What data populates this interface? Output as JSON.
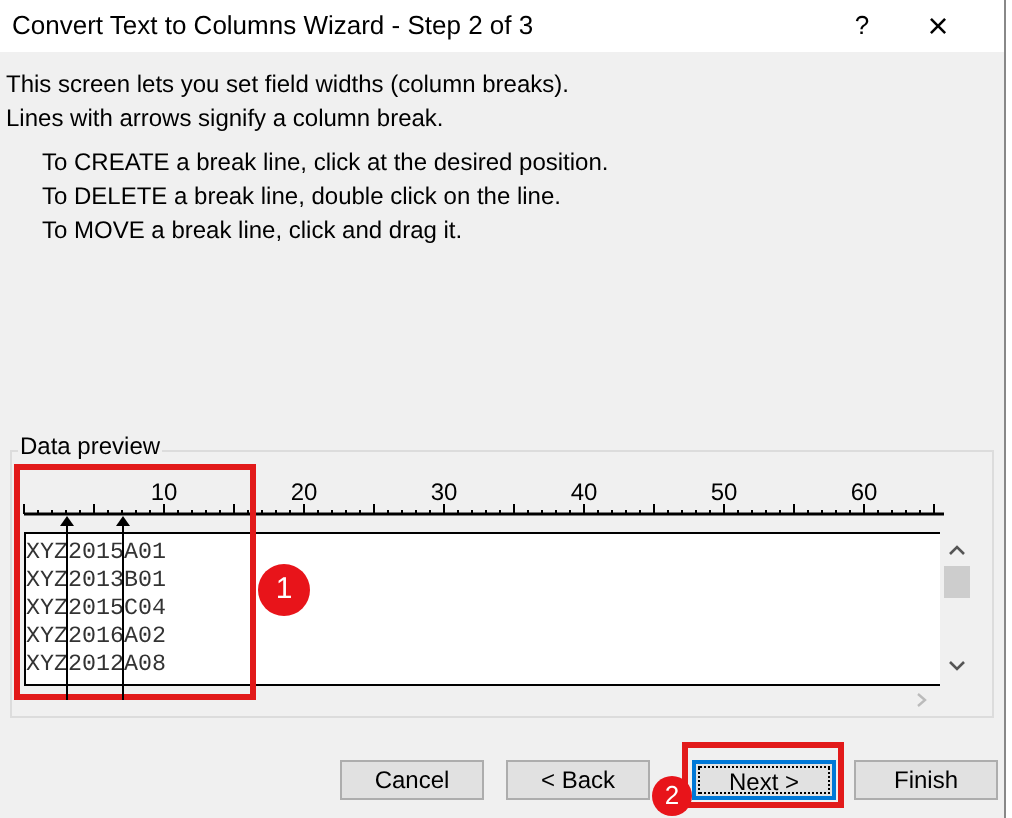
{
  "window": {
    "title": "Convert Text to Columns Wizard - Step 2 of 3",
    "help": "?",
    "close": "×"
  },
  "intro": [
    "This screen lets you set field widths (column breaks).",
    "Lines with arrows signify a column break."
  ],
  "instructions": [
    "To CREATE a break line, click at the desired position.",
    "To DELETE a break line, double click on the line.",
    "To MOVE a break line, click and drag it."
  ],
  "data_preview": {
    "label": "Data preview",
    "ruler": [
      "10",
      "20",
      "30",
      "40",
      "50",
      "60"
    ],
    "rows": [
      "XYZ2015A01",
      "XYZ2013B01",
      "XYZ2015C04",
      "XYZ2016A02",
      "XYZ2012A08"
    ]
  },
  "buttons": [
    {
      "label": "Cancel",
      "default": false
    },
    {
      "label": "< Back",
      "default": false
    },
    {
      "label": "Next >",
      "default": true
    },
    {
      "label": "Finish",
      "default": false
    }
  ],
  "callouts": [
    "1",
    "2"
  ]
}
